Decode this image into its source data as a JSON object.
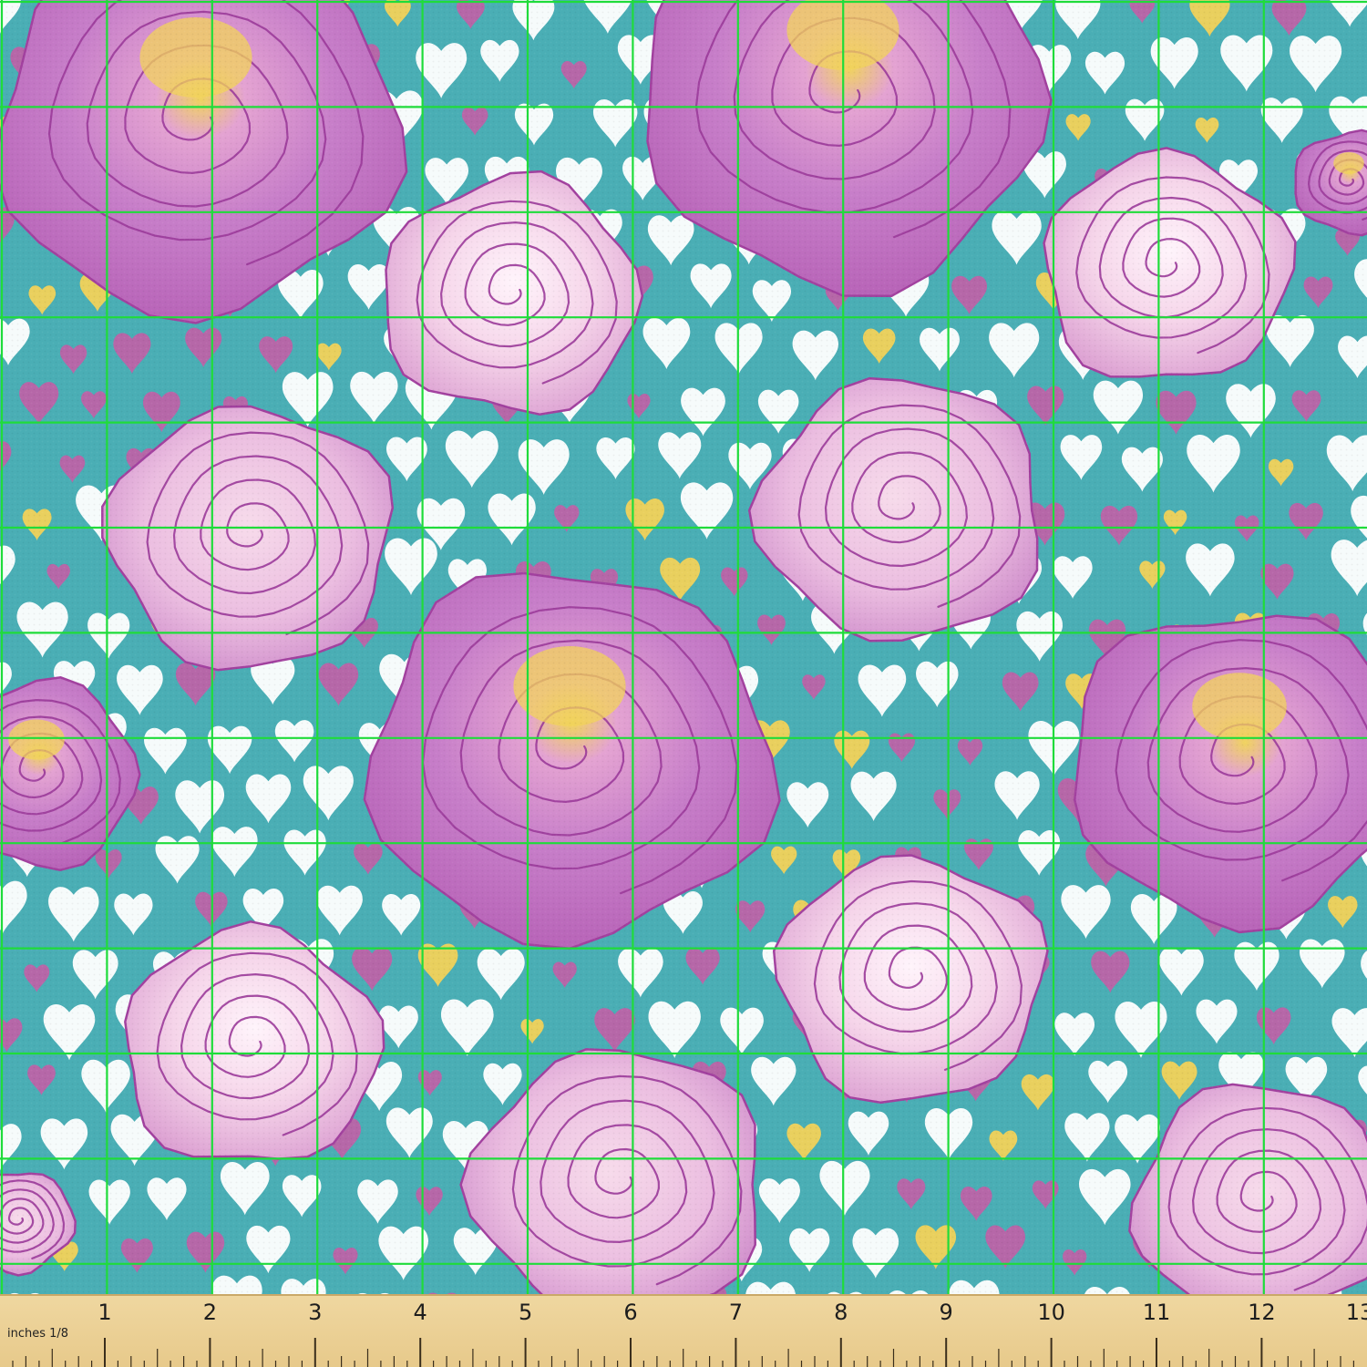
{
  "fabric": {
    "background_color": "#4aaeb5",
    "grid_color": "#1fdc3a",
    "grid_columns": 13,
    "grid_rows": 12,
    "motifs": [
      "rose-flower-icon",
      "heart-icon"
    ],
    "rose_colors": [
      "#c77ec9",
      "#f3cfe6",
      "#a2419f",
      "#f2d35a"
    ],
    "heart_colors": [
      "#ffffff",
      "#c95aa6",
      "#f1d25a"
    ]
  },
  "ruler": {
    "unit_label": "inches 1/8",
    "inch_numbers": [
      "1",
      "2",
      "3",
      "4",
      "5",
      "6",
      "7",
      "8",
      "9",
      "10",
      "11",
      "12",
      "13"
    ],
    "color": "#ecd296"
  }
}
